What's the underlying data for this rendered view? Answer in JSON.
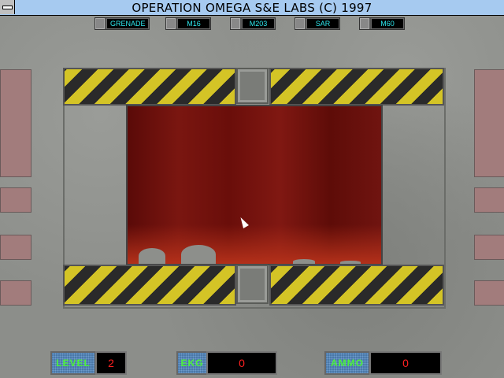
{
  "window": {
    "title": "OPERATION OMEGA S&E LABS (C) 1997"
  },
  "weapons": [
    "GRENADE",
    "M16",
    "M203",
    "SAR",
    "M60"
  ],
  "hud": {
    "level_label": "LEVEL",
    "level_value": "2",
    "ekg_label": "EKG",
    "ekg_value": "0",
    "ammo_label": "AMMO",
    "ammo_value": "0"
  },
  "colors": {
    "titlebar": "#a6caf0",
    "weapon_text": "#2ee8ee",
    "hud_label": "#4cf03c",
    "hud_value": "#ff2020"
  }
}
